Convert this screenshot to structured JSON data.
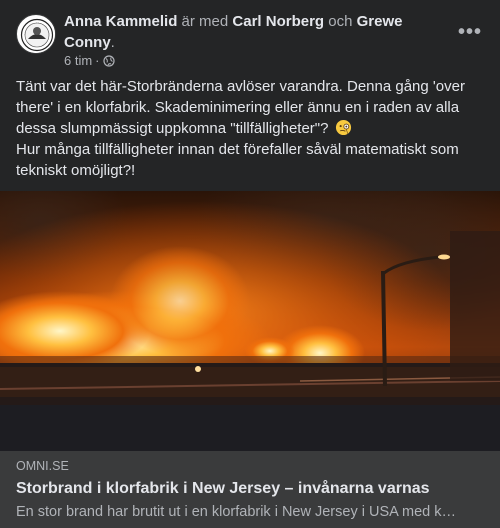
{
  "post": {
    "author": "Anna Kammelid",
    "with_text": "är med",
    "tagged_1": "Carl Norberg",
    "and_text": "och",
    "tagged_2": "Grewe Conny",
    "period": ".",
    "time": "6 tim",
    "separator": "·",
    "privacy_icon": "globe-icon",
    "more_icon": "more-options-icon",
    "text_line1": "Tänt var det här-Storbränderna avlöser varandra. Denna gång 'over there' i en klorfabrik. Skademinimering eller ännu en i raden av alla dessa slumpmässigt uppkomna \"tillfälligheter\"?",
    "emoji": "monocle-face-emoji",
    "text_line2": "Hur många tillfälligheter innan det förefaller såväl matematiskt som tekniskt omöjligt?!"
  },
  "link": {
    "domain": "OMNI.SE",
    "title": "Storbrand i klorfabrik i New Jersey – invånarna varnas",
    "description": "En stor brand har brutit ut i en klorfabrik i New Jersey i USA med k…"
  },
  "colors": {
    "card_bg": "#242526",
    "text_primary": "#e4e6eb",
    "text_secondary": "#b0b3b8",
    "link_bg": "#3a3b3c"
  }
}
